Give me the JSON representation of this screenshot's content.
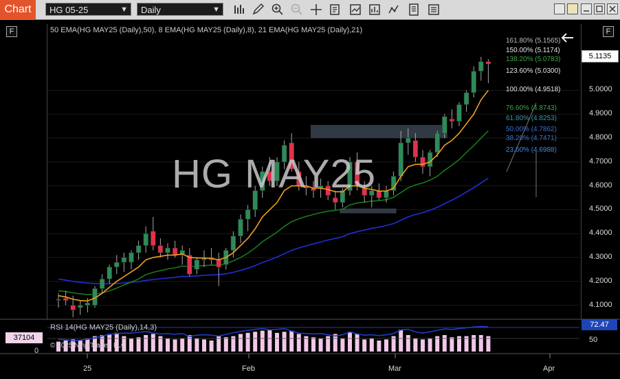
{
  "toolbar": {
    "chart_tab": "Chart",
    "instrument": "HG 05-25",
    "interval": "Daily",
    "icons": [
      "bar-type-icon",
      "draw-pencil-icon",
      "zoom-in-icon",
      "zoom-out-icon",
      "crosshair-icon",
      "data-box-icon",
      "indicators-icon",
      "strategies-icon",
      "properties-icon",
      "chart-properties-icon"
    ],
    "window_buttons": [
      "restore-icon",
      "minimize-icon",
      "maximize-icon",
      "close-icon"
    ]
  },
  "indicators_label": "50 EMA(HG MAY25 (Daily),50), 8 EMA(HG MAY25 (Daily),8), 21 EMA(HG MAY25 (Daily),21)",
  "watermark": "HG MAY25",
  "rsi_label": "RSI 14(HG MAY25 (Daily),14,3)",
  "copyright": "© 2025 NinjaTrader, LLC",
  "last_price": "5.1135",
  "rsi_value": "72.47",
  "volume_value": "37104",
  "volume_axis": [
    "0"
  ],
  "rsi_axis": [
    "50"
  ],
  "fib_levels": [
    {
      "label": "161.80% (5.1565)",
      "color": "#bdbdbd"
    },
    {
      "label": "150.00% (5.1174)",
      "color": "#e6e6e6"
    },
    {
      "label": "138.20% (5.0783)",
      "color": "#3aa84a"
    },
    {
      "label": "123.60% (5.0300)",
      "color": "#e6e6e6"
    },
    {
      "label": "100.00% (4.9518)",
      "color": "#e6e6e6"
    },
    {
      "label": "76.60% (4.8743)",
      "color": "#3aa84a"
    },
    {
      "label": "61.80% (4.8253)",
      "color": "#3a9ab0"
    },
    {
      "label": "50.00% (4.7862)",
      "color": "#3f6fd0"
    },
    {
      "label": "38.20% (4.7471)",
      "color": "#3f6fd0"
    },
    {
      "label": "23.60% (4.6988)",
      "color": "#3f8ae6"
    }
  ],
  "colors": {
    "up": "#2e8b57",
    "down": "#e0324b",
    "ema8": "#f0a020",
    "ema21": "#1a7a1a",
    "ema50": "#1f2fd8",
    "rsi": "#1e3cc8",
    "volume": "#f0c8e8"
  },
  "chart_data": {
    "type": "candlestick",
    "title": "HG MAY25",
    "y_axis_ticks": [
      "5.0000",
      "4.9000",
      "4.8000",
      "4.7000",
      "4.6000",
      "4.5000",
      "4.4000",
      "4.3000",
      "4.2000",
      "4.1000"
    ],
    "ylim": [
      4.05,
      5.24
    ],
    "x_axis_ticks": [
      "25",
      "Feb",
      "Mar",
      "Apr"
    ],
    "candles": [
      {
        "o": 4.125,
        "h": 4.15,
        "l": 4.09,
        "c": 4.125
      },
      {
        "o": 4.13,
        "h": 4.16,
        "l": 4.1,
        "c": 4.12
      },
      {
        "o": 4.1,
        "h": 4.14,
        "l": 4.05,
        "c": 4.08
      },
      {
        "o": 4.09,
        "h": 4.12,
        "l": 4.06,
        "c": 4.1
      },
      {
        "o": 4.1,
        "h": 4.13,
        "l": 4.07,
        "c": 4.11
      },
      {
        "o": 4.1,
        "h": 4.18,
        "l": 4.09,
        "c": 4.17
      },
      {
        "o": 4.17,
        "h": 4.23,
        "l": 4.15,
        "c": 4.21
      },
      {
        "o": 4.21,
        "h": 4.27,
        "l": 4.19,
        "c": 4.26
      },
      {
        "o": 4.26,
        "h": 4.31,
        "l": 4.23,
        "c": 4.28
      },
      {
        "o": 4.28,
        "h": 4.32,
        "l": 4.24,
        "c": 4.3
      },
      {
        "o": 4.28,
        "h": 4.33,
        "l": 4.25,
        "c": 4.32
      },
      {
        "o": 4.32,
        "h": 4.37,
        "l": 4.29,
        "c": 4.35
      },
      {
        "o": 4.35,
        "h": 4.43,
        "l": 4.32,
        "c": 4.4
      },
      {
        "o": 4.41,
        "h": 4.47,
        "l": 4.33,
        "c": 4.35
      },
      {
        "o": 4.35,
        "h": 4.38,
        "l": 4.3,
        "c": 4.32
      },
      {
        "o": 4.32,
        "h": 4.36,
        "l": 4.29,
        "c": 4.34
      },
      {
        "o": 4.34,
        "h": 4.37,
        "l": 4.3,
        "c": 4.31
      },
      {
        "o": 4.31,
        "h": 4.35,
        "l": 4.27,
        "c": 4.33
      },
      {
        "o": 4.31,
        "h": 4.34,
        "l": 4.22,
        "c": 4.23
      },
      {
        "o": 4.25,
        "h": 4.3,
        "l": 4.23,
        "c": 4.29
      },
      {
        "o": 4.29,
        "h": 4.33,
        "l": 4.26,
        "c": 4.3
      },
      {
        "o": 4.3,
        "h": 4.34,
        "l": 4.27,
        "c": 4.29
      },
      {
        "o": 4.29,
        "h": 4.32,
        "l": 4.18,
        "c": 4.26
      },
      {
        "o": 4.27,
        "h": 4.34,
        "l": 4.25,
        "c": 4.33
      },
      {
        "o": 4.33,
        "h": 4.41,
        "l": 4.3,
        "c": 4.39
      },
      {
        "o": 4.39,
        "h": 4.48,
        "l": 4.36,
        "c": 4.46
      },
      {
        "o": 4.46,
        "h": 4.52,
        "l": 4.41,
        "c": 4.5
      },
      {
        "o": 4.5,
        "h": 4.6,
        "l": 4.47,
        "c": 4.58
      },
      {
        "o": 4.58,
        "h": 4.68,
        "l": 4.55,
        "c": 4.66
      },
      {
        "o": 4.66,
        "h": 4.72,
        "l": 4.6,
        "c": 4.62
      },
      {
        "o": 4.62,
        "h": 4.72,
        "l": 4.6,
        "c": 4.7
      },
      {
        "o": 4.7,
        "h": 4.79,
        "l": 4.67,
        "c": 4.77
      },
      {
        "o": 4.78,
        "h": 4.82,
        "l": 4.66,
        "c": 4.67
      },
      {
        "o": 4.66,
        "h": 4.7,
        "l": 4.58,
        "c": 4.6
      },
      {
        "o": 4.6,
        "h": 4.64,
        "l": 4.56,
        "c": 4.59
      },
      {
        "o": 4.59,
        "h": 4.62,
        "l": 4.55,
        "c": 4.58
      },
      {
        "o": 4.59,
        "h": 4.63,
        "l": 4.55,
        "c": 4.6
      },
      {
        "o": 4.6,
        "h": 4.62,
        "l": 4.54,
        "c": 4.56
      },
      {
        "o": 4.55,
        "h": 4.58,
        "l": 4.5,
        "c": 4.53
      },
      {
        "o": 4.53,
        "h": 4.59,
        "l": 4.51,
        "c": 4.58
      },
      {
        "o": 4.58,
        "h": 4.72,
        "l": 4.56,
        "c": 4.7
      },
      {
        "o": 4.7,
        "h": 4.74,
        "l": 4.58,
        "c": 4.6
      },
      {
        "o": 4.59,
        "h": 4.62,
        "l": 4.53,
        "c": 4.56
      },
      {
        "o": 4.56,
        "h": 4.6,
        "l": 4.51,
        "c": 4.58
      },
      {
        "o": 4.58,
        "h": 4.61,
        "l": 4.54,
        "c": 4.55
      },
      {
        "o": 4.55,
        "h": 4.6,
        "l": 4.53,
        "c": 4.58
      },
      {
        "o": 4.58,
        "h": 4.66,
        "l": 4.56,
        "c": 4.64
      },
      {
        "o": 4.64,
        "h": 4.83,
        "l": 4.62,
        "c": 4.78
      },
      {
        "o": 4.78,
        "h": 4.84,
        "l": 4.73,
        "c": 4.8
      },
      {
        "o": 4.79,
        "h": 4.82,
        "l": 4.7,
        "c": 4.72
      },
      {
        "o": 4.72,
        "h": 4.75,
        "l": 4.65,
        "c": 4.68
      },
      {
        "o": 4.68,
        "h": 4.75,
        "l": 4.64,
        "c": 4.74
      },
      {
        "o": 4.74,
        "h": 4.83,
        "l": 4.72,
        "c": 4.82
      },
      {
        "o": 4.82,
        "h": 4.9,
        "l": 4.8,
        "c": 4.89
      },
      {
        "o": 4.88,
        "h": 4.92,
        "l": 4.84,
        "c": 4.87
      },
      {
        "o": 4.87,
        "h": 4.95,
        "l": 4.85,
        "c": 4.94
      },
      {
        "o": 4.94,
        "h": 5.0,
        "l": 4.91,
        "c": 4.99
      },
      {
        "o": 4.99,
        "h": 5.1,
        "l": 4.97,
        "c": 5.08
      },
      {
        "o": 5.08,
        "h": 5.14,
        "l": 5.04,
        "c": 5.12
      },
      {
        "o": 5.12,
        "h": 5.13,
        "l": 5.03,
        "c": 5.11
      }
    ],
    "ema8": [
      4.14,
      4.135,
      4.125,
      4.12,
      4.118,
      4.13,
      4.15,
      4.175,
      4.2,
      4.22,
      4.24,
      4.26,
      4.29,
      4.3,
      4.305,
      4.31,
      4.31,
      4.315,
      4.3,
      4.298,
      4.298,
      4.296,
      4.29,
      4.3,
      4.32,
      4.35,
      4.38,
      4.42,
      4.47,
      4.5,
      4.53,
      4.58,
      4.6,
      4.6,
      4.6,
      4.59,
      4.59,
      4.585,
      4.575,
      4.575,
      4.6,
      4.6,
      4.59,
      4.585,
      4.578,
      4.578,
      4.59,
      4.64,
      4.68,
      4.69,
      4.69,
      4.7,
      4.73,
      4.77,
      4.79,
      4.82,
      4.86,
      4.9,
      4.96,
      5.0
    ],
    "ema21": [
      4.16,
      4.158,
      4.152,
      4.148,
      4.145,
      4.146,
      4.152,
      4.16,
      4.172,
      4.185,
      4.197,
      4.21,
      4.228,
      4.238,
      4.245,
      4.252,
      4.257,
      4.264,
      4.262,
      4.264,
      4.266,
      4.268,
      4.268,
      4.274,
      4.286,
      4.3,
      4.318,
      4.34,
      4.366,
      4.386,
      4.406,
      4.43,
      4.45,
      4.462,
      4.472,
      4.48,
      4.488,
      4.494,
      4.497,
      4.502,
      4.52,
      4.528,
      4.532,
      4.536,
      4.538,
      4.542,
      4.552,
      4.572,
      4.592,
      4.604,
      4.612,
      4.624,
      4.64,
      4.665,
      4.686,
      4.71,
      4.74,
      4.768,
      4.8,
      4.83
    ],
    "ema50": [
      4.21,
      4.205,
      4.2,
      4.196,
      4.193,
      4.191,
      4.19,
      4.19,
      4.191,
      4.193,
      4.196,
      4.199,
      4.204,
      4.208,
      4.211,
      4.214,
      4.217,
      4.22,
      4.221,
      4.223,
      4.225,
      4.227,
      4.228,
      4.232,
      4.238,
      4.246,
      4.255,
      4.266,
      4.279,
      4.29,
      4.302,
      4.316,
      4.33,
      4.34,
      4.349,
      4.357,
      4.365,
      4.373,
      4.38,
      4.387,
      4.4,
      4.408,
      4.415,
      4.422,
      4.427,
      4.434,
      4.442,
      4.456,
      4.47,
      4.48,
      4.488,
      4.498,
      4.51,
      4.525,
      4.54,
      4.556,
      4.574,
      4.592,
      4.612,
      4.632
    ],
    "rsi": [
      48,
      47,
      44,
      46,
      48,
      52,
      56,
      60,
      62,
      63,
      63,
      65,
      67,
      63,
      61,
      62,
      60,
      62,
      55,
      58,
      59,
      58,
      56,
      60,
      64,
      67,
      70,
      72,
      74,
      71,
      72,
      74,
      68,
      63,
      62,
      61,
      62,
      59,
      56,
      59,
      66,
      61,
      58,
      59,
      57,
      59,
      62,
      71,
      72,
      66,
      63,
      66,
      70,
      73,
      72,
      74,
      76,
      78,
      79,
      78
    ],
    "volume": [
      0.45,
      0.5,
      0.55,
      0.5,
      0.6,
      0.7,
      0.75,
      0.8,
      0.85,
      0.7,
      0.6,
      0.65,
      0.75,
      0.8,
      0.7,
      0.6,
      0.55,
      0.6,
      0.75,
      0.6,
      0.55,
      0.5,
      0.7,
      0.65,
      0.7,
      0.8,
      0.85,
      0.9,
      0.95,
      1.0,
      0.85,
      0.9,
      0.95,
      0.8,
      0.7,
      0.65,
      0.6,
      0.7,
      0.8,
      0.6,
      0.9,
      0.8,
      0.55,
      0.6,
      0.5,
      0.55,
      0.7,
      1.0,
      0.75,
      0.6,
      0.55,
      0.6,
      0.7,
      0.75,
      0.65,
      0.7,
      0.7,
      0.75,
      0.75,
      0.7
    ],
    "zones": [
      {
        "from": 4.8,
        "to": 4.855,
        "start_index": 35,
        "end_index": 53
      },
      {
        "from": 4.485,
        "to": 4.505,
        "start_index": 39,
        "end_index": 46
      }
    ]
  }
}
